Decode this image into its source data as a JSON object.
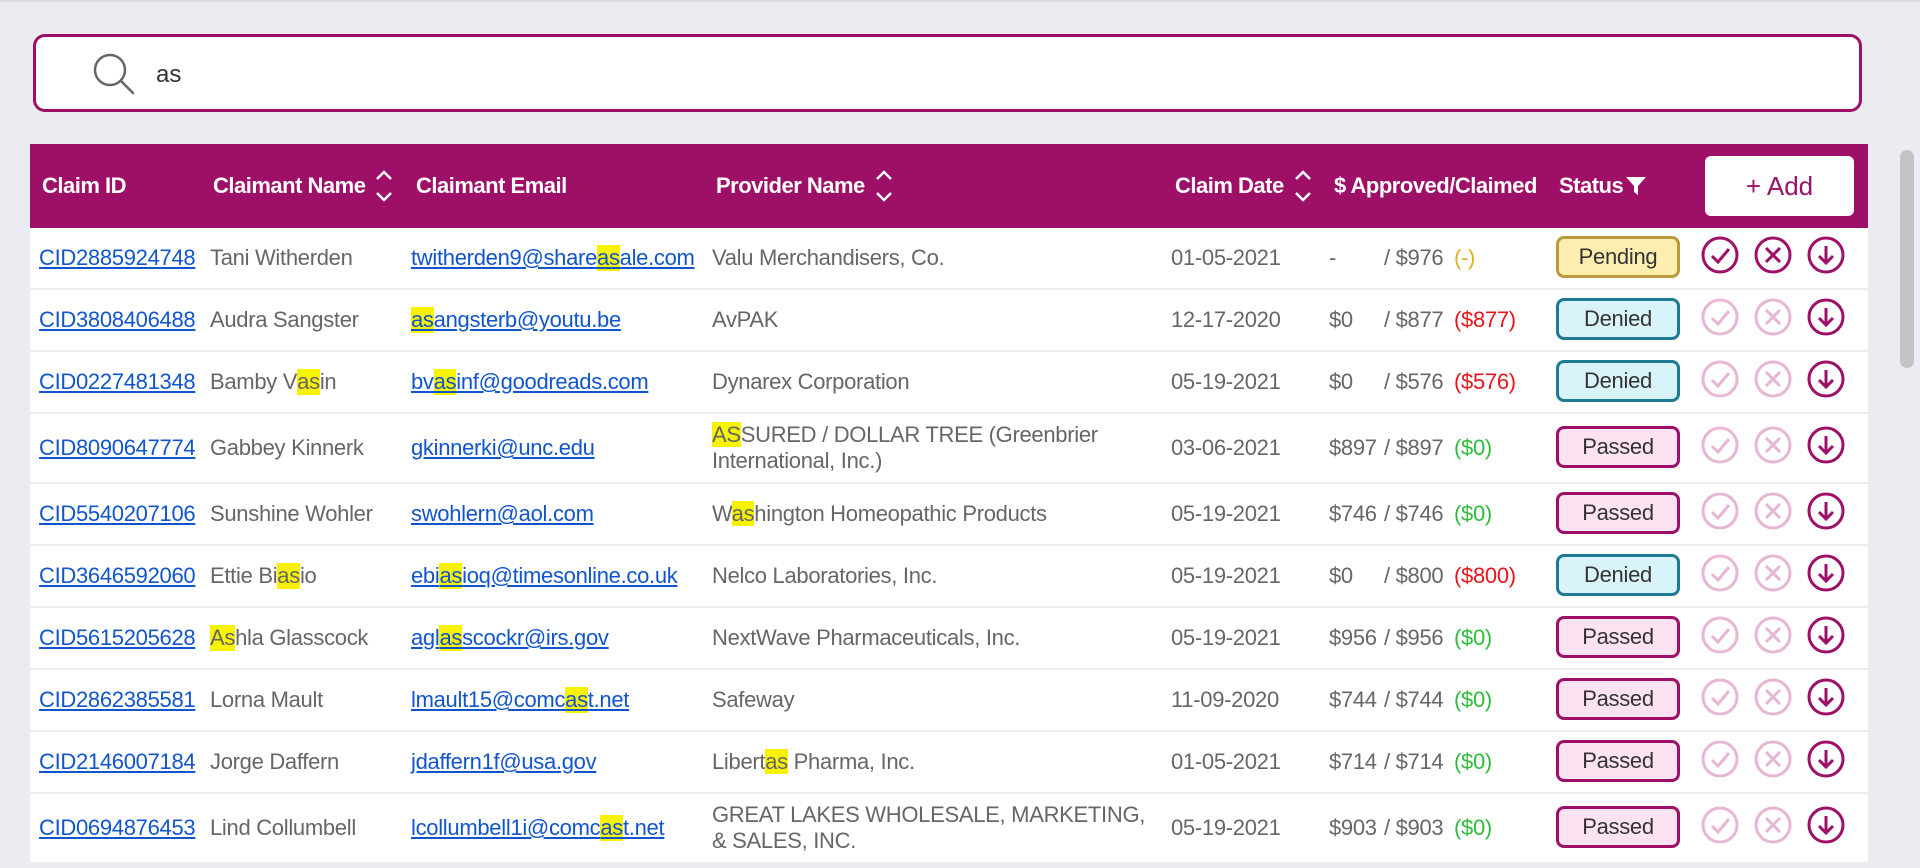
{
  "search": {
    "value": "as",
    "placeholder": ""
  },
  "table": {
    "headers": {
      "claim_id": "Claim ID",
      "claimant_name": "Claimant Name",
      "claimant_email": "Claimant Email",
      "provider_name": "Provider Name",
      "claim_date": "Claim Date",
      "amount": "$ Approved/Claimed",
      "status": "Status"
    },
    "add_label": "+ Add",
    "rows": [
      {
        "claim_id": "CID2885924748",
        "name": [
          "Tani Witherden"
        ],
        "email": [
          "twitherden9@share",
          "as",
          "ale.com"
        ],
        "provider": [
          "Valu Merchandisers, Co."
        ],
        "date": "01-05-2021",
        "approved": "-",
        "claimed": "/ $976",
        "diff": "(-)",
        "diff_type": "dash",
        "status": "Pending",
        "actions_enabled": true
      },
      {
        "claim_id": "CID3808406488",
        "name": [
          "Audra Sangster"
        ],
        "email": [
          "",
          "as",
          "angsterb@youtu.be"
        ],
        "provider": [
          "AvPAK"
        ],
        "date": "12-17-2020",
        "approved": "$0",
        "claimed": "/ $877",
        "diff": "($877)",
        "diff_type": "neg",
        "status": "Denied",
        "actions_enabled": false
      },
      {
        "claim_id": "CID0227481348",
        "name": [
          "Bamby V",
          "as",
          "in"
        ],
        "email": [
          "bv",
          "as",
          "inf@goodreads.com"
        ],
        "provider": [
          "Dynarex Corporation"
        ],
        "date": "05-19-2021",
        "approved": "$0",
        "claimed": "/ $576",
        "diff": "($576)",
        "diff_type": "neg",
        "status": "Denied",
        "actions_enabled": false
      },
      {
        "claim_id": "CID8090647774",
        "name": [
          "Gabbey Kinnerk"
        ],
        "email": [
          "gkinnerki@unc.edu"
        ],
        "provider": [
          "",
          "AS",
          "SURED / DOLLAR TREE (Greenbrier International, Inc.)"
        ],
        "date": "03-06-2021",
        "approved": "$897",
        "claimed": "/ $897",
        "diff": "($0)",
        "diff_type": "zero",
        "status": "Passed",
        "actions_enabled": false,
        "tall": true
      },
      {
        "claim_id": "CID5540207106",
        "name": [
          "Sunshine Wohler"
        ],
        "email": [
          "swohlern@aol.com"
        ],
        "provider": [
          "W",
          "as",
          "hington Homeopathic Products"
        ],
        "date": "05-19-2021",
        "approved": "$746",
        "claimed": "/ $746",
        "diff": "($0)",
        "diff_type": "zero",
        "status": "Passed",
        "actions_enabled": false
      },
      {
        "claim_id": "CID3646592060",
        "name": [
          "Ettie Bi",
          "as",
          "io"
        ],
        "email": [
          "ebi",
          "as",
          "ioq@timesonline.co.uk"
        ],
        "provider": [
          "Nelco Laboratories, Inc."
        ],
        "date": "05-19-2021",
        "approved": "$0",
        "claimed": "/ $800",
        "diff": "($800)",
        "diff_type": "neg",
        "status": "Denied",
        "actions_enabled": false
      },
      {
        "claim_id": "CID5615205628",
        "name": [
          "",
          "As",
          "hla Glasscock"
        ],
        "email": [
          "agl",
          "as",
          "scockr@irs.gov"
        ],
        "provider": [
          "NextWave Pharmaceuticals, Inc."
        ],
        "date": "05-19-2021",
        "approved": "$956",
        "claimed": "/ $956",
        "diff": "($0)",
        "diff_type": "zero",
        "status": "Passed",
        "actions_enabled": false
      },
      {
        "claim_id": "CID2862385581",
        "name": [
          "Lorna Mault"
        ],
        "email": [
          "lmault15@comc",
          "as",
          "t.net"
        ],
        "provider": [
          "Safeway"
        ],
        "date": "11-09-2020",
        "approved": "$744",
        "claimed": "/ $744",
        "diff": "($0)",
        "diff_type": "zero",
        "status": "Passed",
        "actions_enabled": false
      },
      {
        "claim_id": "CID2146007184",
        "name": [
          "Jorge Daffern"
        ],
        "email": [
          "jdaffern1f@usa.gov"
        ],
        "provider": [
          "Libert",
          "as",
          " Pharma, Inc."
        ],
        "date": "01-05-2021",
        "approved": "$714",
        "claimed": "/ $714",
        "diff": "($0)",
        "diff_type": "zero",
        "status": "Passed",
        "actions_enabled": false
      },
      {
        "claim_id": "CID0694876453",
        "name": [
          "Lind Collumbell"
        ],
        "email": [
          "lcollumbell1i@comc",
          "as",
          "t.net"
        ],
        "provider": [
          "GREAT LAKES WHOLESALE, MARKETING, & SALES, INC."
        ],
        "date": "05-19-2021",
        "approved": "$903",
        "claimed": "/ $903",
        "diff": "($0)",
        "diff_type": "zero",
        "status": "Passed",
        "actions_enabled": false,
        "tall": true
      }
    ]
  },
  "colors": {
    "header_bg": "#9e1068",
    "link": "#1155cc",
    "highlight": "#f7f200",
    "negative": "#e8141e",
    "zero": "#2fbd3d",
    "pending_bg": "#fdeeb0",
    "denied_bg": "#d9f3fb",
    "passed_bg": "#fde3f2"
  },
  "icons": {
    "search": "search-icon",
    "sort": "sort-arrows-icon",
    "filter": "filter-icon",
    "approve": "check-circle-icon",
    "reject": "x-circle-icon",
    "download": "download-circle-icon"
  }
}
